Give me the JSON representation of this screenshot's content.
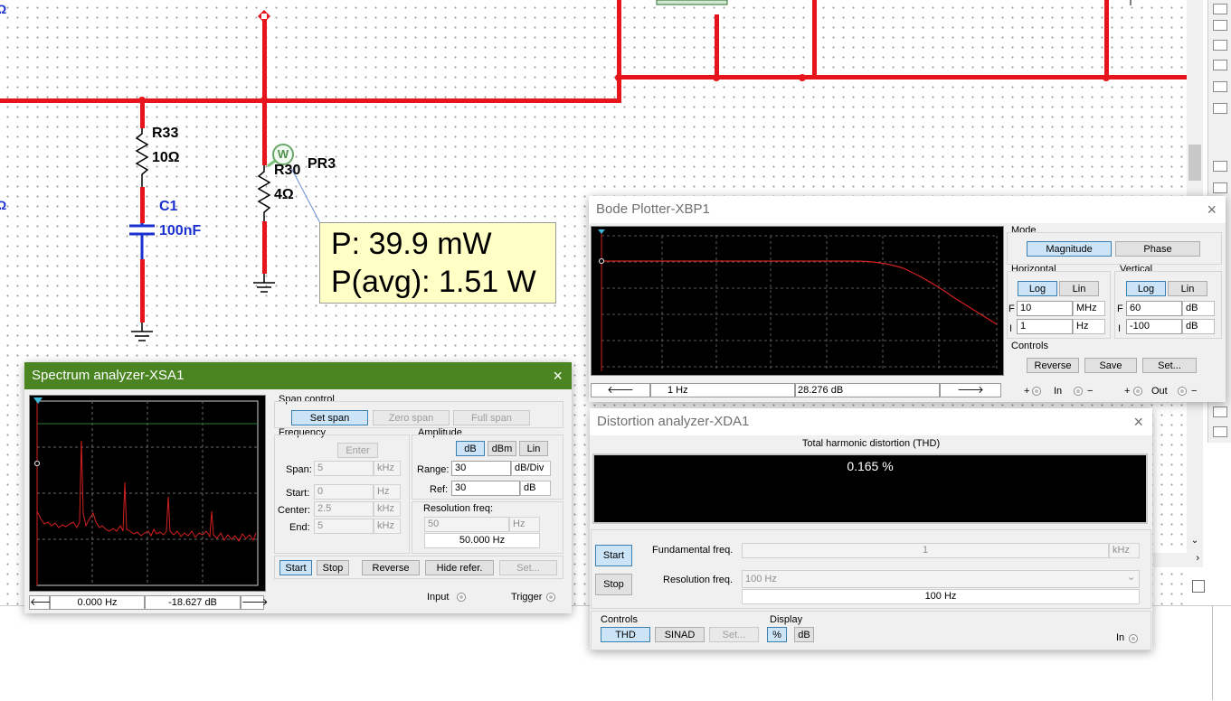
{
  "schematic": {
    "labels": {
      "r33_name": "R33",
      "r33_value": "10Ω",
      "c1_name": "C1",
      "c1_value": "100nF",
      "r30_name": "R30",
      "r30_value": "4Ω",
      "probe_name": "PR3",
      "probe_symbol": "W",
      "edge_fragment_1": "Ω",
      "edge_fragment_2": "Ω"
    },
    "probe_readout": {
      "line1": "P: 39.9 mW",
      "line2": "P(avg): 1.51 W"
    },
    "colors": {
      "wire": "#e8141c",
      "component_label_blue": "#1a2fd0"
    }
  },
  "bode_plotter": {
    "title": "Bode Plotter-XBP1",
    "close_icon": "×",
    "mode_label": "Mode",
    "magnitude_btn": "Magnitude",
    "phase_btn": "Phase",
    "horizontal_label": "Horizontal",
    "vertical_label": "Vertical",
    "h_log": "Log",
    "h_lin": "Lin",
    "v_log": "Log",
    "v_lin": "Lin",
    "f_label": "F",
    "i_label": "I",
    "h_final_value": "10",
    "h_final_unit": "MHz",
    "h_initial_value": "1",
    "h_initial_unit": "Hz",
    "v_final_value": "60",
    "v_final_unit": "dB",
    "v_initial_value": "-100",
    "v_initial_unit": "dB",
    "controls_label": "Controls",
    "reverse_btn": "Reverse",
    "save_btn": "Save",
    "set_btn": "Set...",
    "cursor_x": "1 Hz",
    "cursor_y": "28.276 dB",
    "in_label": "In",
    "out_label": "Out",
    "plus": "+",
    "minus": "−"
  },
  "spectrum_analyzer": {
    "title": "Spectrum analyzer-XSA1",
    "close_icon": "×",
    "span_control_label": "Span control",
    "set_span_btn": "Set span",
    "zero_span_btn": "Zero span",
    "full_span_btn": "Full span",
    "frequency_label": "Frequency",
    "enter_btn": "Enter",
    "span_label": "Span:",
    "span_value": "5",
    "span_unit": "kHz",
    "start_label": "Start:",
    "start_value": "0",
    "start_unit": "Hz",
    "center_label": "Center:",
    "center_value": "2.5",
    "center_unit": "kHz",
    "end_label": "End:",
    "end_value": "5",
    "end_unit": "kHz",
    "amplitude_label": "Amplitude",
    "db_btn": "dB",
    "dbm_btn": "dBm",
    "lin_btn": "Lin",
    "range_label": "Range:",
    "range_value": "30",
    "range_unit": "dB/Div",
    "ref_label": "Ref:",
    "ref_value": "30",
    "ref_unit": "dB",
    "resolution_label": "Resolution freq:",
    "resolution_value": "50",
    "resolution_unit": "Hz",
    "resolution_readout": "50.000  Hz",
    "start_btn": "Start",
    "stop_btn": "Stop",
    "reverse_btn": "Reverse",
    "hide_ref_btn": "Hide refer.",
    "set_btn": "Set...",
    "cursor_x": "0.000  Hz",
    "cursor_y": "-18.627  dB",
    "input_label": "Input",
    "trigger_label": "Trigger"
  },
  "distortion_analyzer": {
    "title": "Distortion analyzer-XDA1",
    "close_icon": "×",
    "thd_header": "Total harmonic distortion (THD)",
    "thd_value": "0.165 %",
    "start_btn": "Start",
    "stop_btn": "Stop",
    "fundamental_label": "Fundamental freq.",
    "fundamental_value": "1",
    "fundamental_unit": "kHz",
    "resolution_label": "Resolution freq.",
    "resolution_select": "100 Hz",
    "resolution_readout": "100 Hz",
    "controls_label": "Controls",
    "thd_btn": "THD",
    "sinad_btn": "SINAD",
    "set_btn": "Set...",
    "display_label": "Display",
    "percent_btn": "%",
    "db_btn": "dB",
    "in_label": "In"
  }
}
